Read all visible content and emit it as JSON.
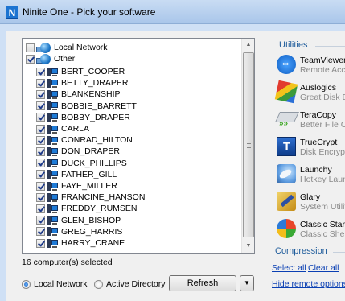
{
  "window": {
    "title": "Ninite One - Pick your software",
    "logo_letter": "N"
  },
  "tree": {
    "root_items": [
      {
        "label": "Local Network",
        "checked": false
      },
      {
        "label": "Other",
        "checked": true
      }
    ],
    "computers": [
      "BERT_COOPER",
      "BETTY_DRAPER",
      "BLANKENSHIP",
      "BOBBIE_BARRETT",
      "BOBBY_DRAPER",
      "CARLA",
      "CONRAD_HILTON",
      "DON_DRAPER",
      "DUCK_PHILLIPS",
      "FATHER_GILL",
      "FAYE_MILLER",
      "FRANCINE_HANSON",
      "FREDDY_RUMSEN",
      "GLEN_BISHOP",
      "GREG_HARRIS",
      "HARRY_CRANE"
    ]
  },
  "status": {
    "selected_count": "16 computer(s) selected"
  },
  "source": {
    "options": [
      "Local Network",
      "Active Directory"
    ],
    "selected": "Local Network",
    "refresh_label": "Refresh",
    "dropdown_glyph": "▼"
  },
  "scrollbar": {
    "up_glyph": "▲",
    "down_glyph": "▼"
  },
  "utilities": {
    "heading": "Utilities",
    "apps": [
      {
        "name": "TeamViewer",
        "desc": "Remote Acce",
        "icon": "teamviewer-icon"
      },
      {
        "name": "Auslogics",
        "desc": "Great Disk D",
        "icon": "auslogics-icon"
      },
      {
        "name": "TeraCopy",
        "desc": "Better File C",
        "icon": "teracopy-icon"
      },
      {
        "name": "TrueCrypt",
        "desc": "Disk Encrypt",
        "icon": "truecrypt-icon"
      },
      {
        "name": "Launchy",
        "desc": "Hotkey Laun",
        "icon": "launchy-icon"
      },
      {
        "name": "Glary",
        "desc": "System Utilit",
        "icon": "glary-icon"
      },
      {
        "name": "Classic Start",
        "desc": "Classic Shell",
        "icon": "classic-start-icon"
      }
    ]
  },
  "compression": {
    "heading": "Compression"
  },
  "links": {
    "select_all": "Select all",
    "clear_all": "Clear all",
    "hide_remote": "Hide remote options"
  }
}
